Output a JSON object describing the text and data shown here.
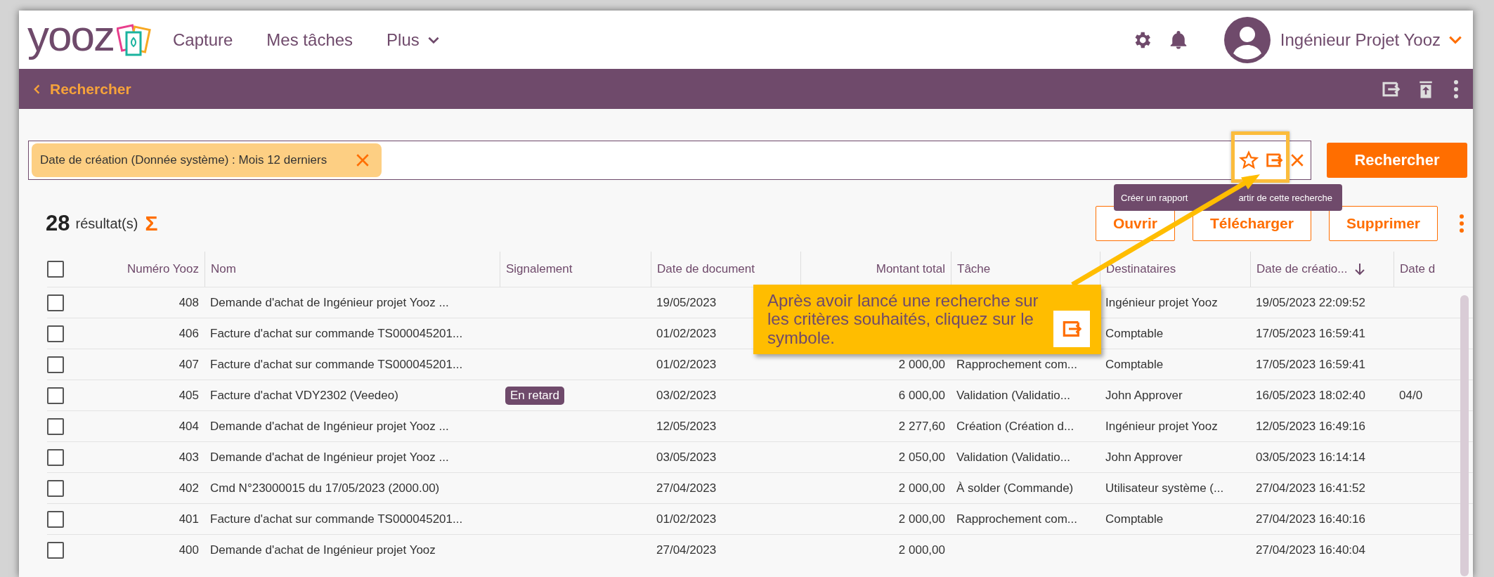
{
  "header": {
    "logo": "yooz",
    "nav": [
      {
        "label": "Capture",
        "kind": "link"
      },
      {
        "label": "Mes tâches",
        "kind": "link"
      },
      {
        "label": "Plus",
        "kind": "menu"
      }
    ],
    "user": "Ingénieur Projet Yooz"
  },
  "toolbar": {
    "back": "Rechercher"
  },
  "search": {
    "chips": [
      {
        "label": "Date de création (Donnée système) : Mois 12 derniers"
      }
    ],
    "button": "Rechercher",
    "tooltip": [
      "Créer un rapport",
      "artir de cette recherche"
    ]
  },
  "results": {
    "count": "28",
    "label": "résultat(s)",
    "sum_symbol": "Σ",
    "actions": [
      "Ouvrir",
      "Télécharger",
      "Supprimer"
    ]
  },
  "table": {
    "select_all": {
      "checked": false
    },
    "columns": [
      {
        "label": "Numéro Yooz",
        "sorted": false
      },
      {
        "label": "Nom",
        "sorted": false
      },
      {
        "label": "Signalement",
        "sorted": false
      },
      {
        "label": "Date de document",
        "sorted": false
      },
      {
        "label": "Montant total",
        "sorted": false
      },
      {
        "label": "Tâche",
        "sorted": false
      },
      {
        "label": "Destinataires",
        "sorted": false
      },
      {
        "label": "Date de créatio...",
        "sorted": true
      },
      {
        "label": "Date d",
        "sorted": false
      }
    ],
    "rows": [
      {
        "checked": false,
        "cells": [
          "408",
          "Demande d'achat de Ingénieur projet Yooz ...",
          null,
          "19/05/2023",
          null,
          null,
          "Ingénieur projet Yooz",
          "19/05/2023 22:09:52",
          null
        ]
      },
      {
        "checked": false,
        "cells": [
          "406",
          "Facture d'achat sur commande TS000045201...",
          null,
          "01/02/2023",
          null,
          null,
          "Comptable",
          "17/05/2023 16:59:41",
          null
        ]
      },
      {
        "checked": false,
        "cells": [
          "407",
          "Facture d'achat sur commande TS000045201...",
          null,
          "01/02/2023",
          "2 000,00",
          "Rapprochement com...",
          "Comptable",
          "17/05/2023 16:59:41",
          null
        ]
      },
      {
        "checked": false,
        "cells": [
          "405",
          "Facture d'achat VDY2302 (Veedeo)",
          "En retard",
          "03/02/2023",
          "6 000,00",
          "Validation (Validatio...",
          "John Approver",
          "16/05/2023 18:02:40",
          "04/0"
        ]
      },
      {
        "checked": false,
        "cells": [
          "404",
          "Demande d'achat de Ingénieur projet Yooz ...",
          null,
          "12/05/2023",
          "2 277,60",
          "Création (Création d...",
          "Ingénieur projet Yooz",
          "12/05/2023 16:49:16",
          null
        ]
      },
      {
        "checked": false,
        "cells": [
          "403",
          "Demande d'achat de Ingénieur projet Yooz ...",
          null,
          "03/05/2023",
          "2 050,00",
          "Validation (Validatio...",
          "John Approver",
          "03/05/2023 16:14:14",
          null
        ]
      },
      {
        "checked": false,
        "cells": [
          "402",
          "Cmd N°23000015 du 17/05/2023 (2000.00)",
          null,
          "27/04/2023",
          "2 000,00",
          "À solder (Commande)",
          "Utilisateur système (...",
          "27/04/2023 16:41:52",
          null
        ]
      },
      {
        "checked": false,
        "cells": [
          "401",
          "Facture d'achat sur commande TS000045201...",
          null,
          "01/02/2023",
          "2 000,00",
          "Rapprochement com...",
          "Comptable",
          "27/04/2023 16:40:16",
          null
        ]
      },
      {
        "checked": false,
        "cells": [
          "400",
          "Demande d'achat de Ingénieur projet Yooz",
          null,
          "27/04/2023",
          "2 000,00",
          null,
          null,
          "27/04/2023 16:40:04",
          null
        ]
      }
    ]
  },
  "callout": {
    "text": "Après avoir lancé une recherche sur les critères souhaités, cliquez sur le symbole."
  }
}
